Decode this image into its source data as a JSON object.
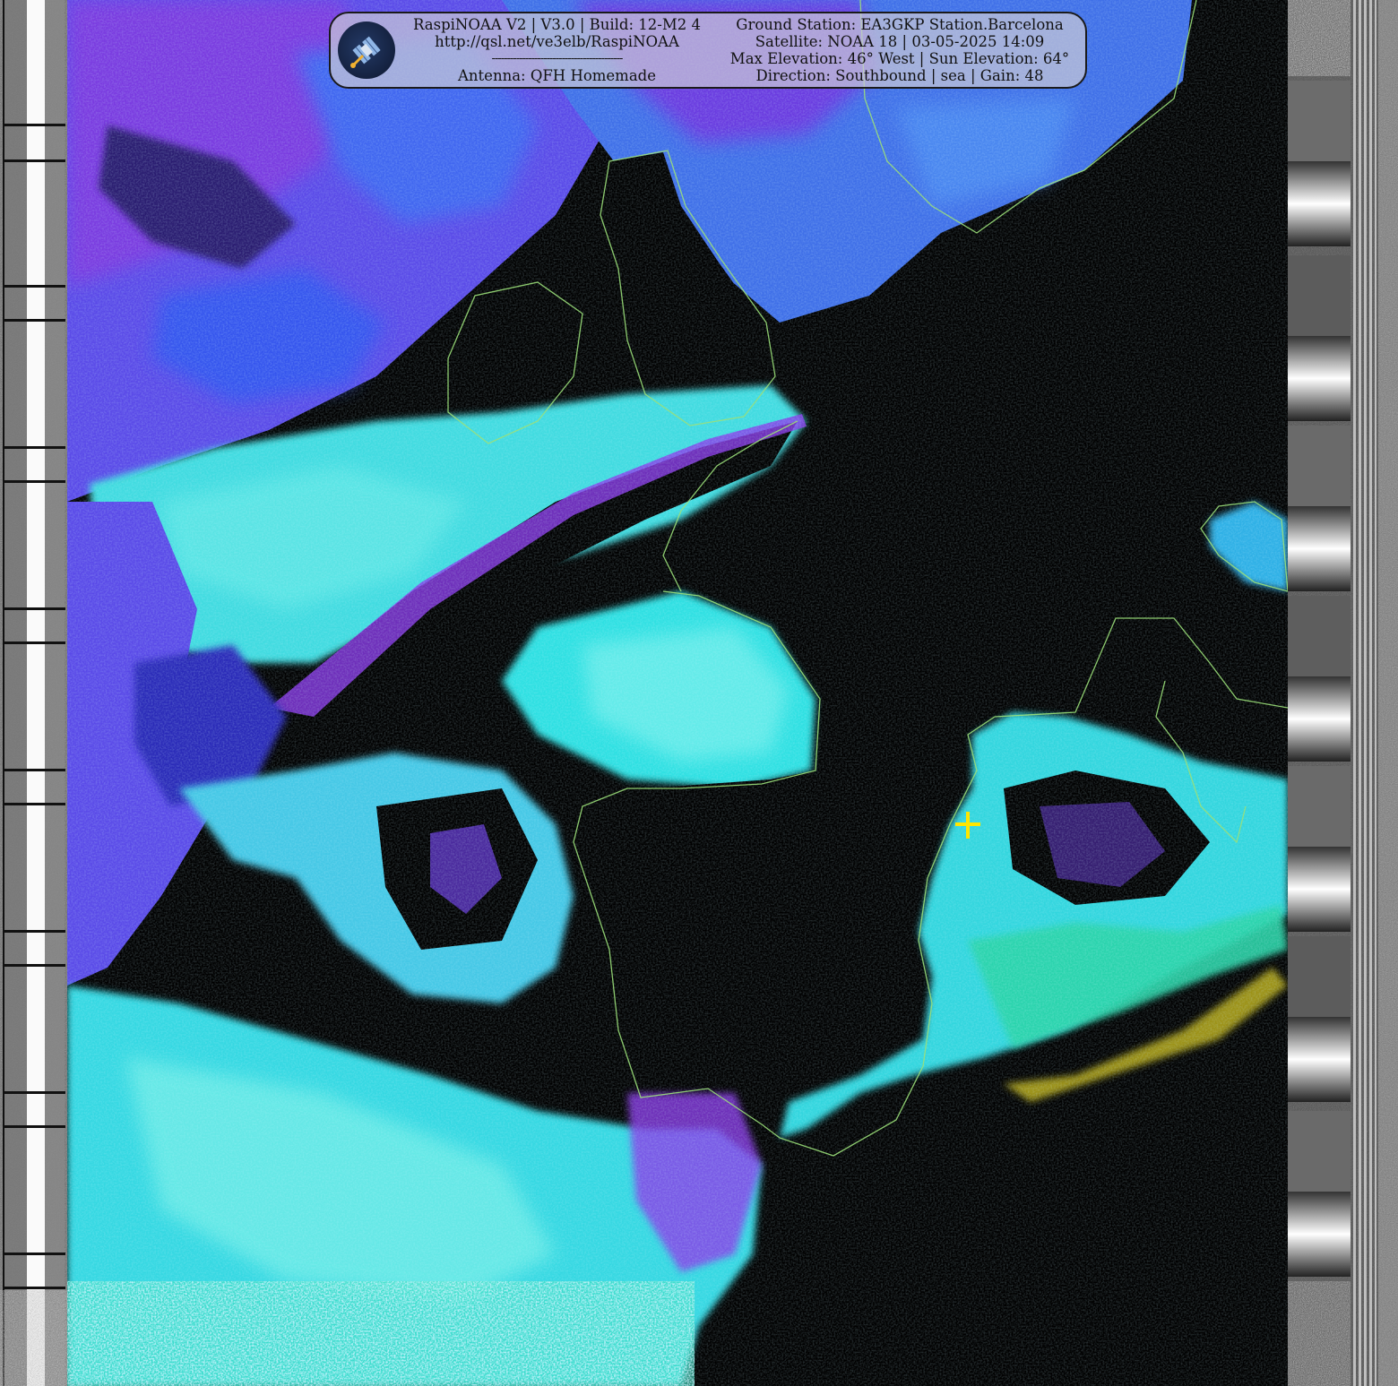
{
  "banner": {
    "left_lines": [
      "RaspiNOAA V2 | V3.0 | Build: 12-M2 4",
      "http://qsl.net/ve3elb/RaspiNOAA",
      "-------------------------------------------",
      "Antenna: QFH Homemade"
    ],
    "right_lines": [
      "Ground Station: EA3GKP Station.Barcelona",
      "Satellite: NOAA 18 | 03-05-2025 14:09",
      "Max Elevation: 46° West | Sun Elevation: 64°",
      "Direction: Southbound | sea | Gain: 48"
    ],
    "logo_icon": "satellite-icon"
  },
  "image": {
    "marker_icon": "station-cross-icon",
    "colors": {
      "background": "#000000",
      "coastline": "#9be07a",
      "marker": "#ffe600",
      "cloud_cyan": "#38e8d8",
      "cloud_blue": "#3c5cf0",
      "cloud_violet": "#8a3ae8"
    }
  }
}
